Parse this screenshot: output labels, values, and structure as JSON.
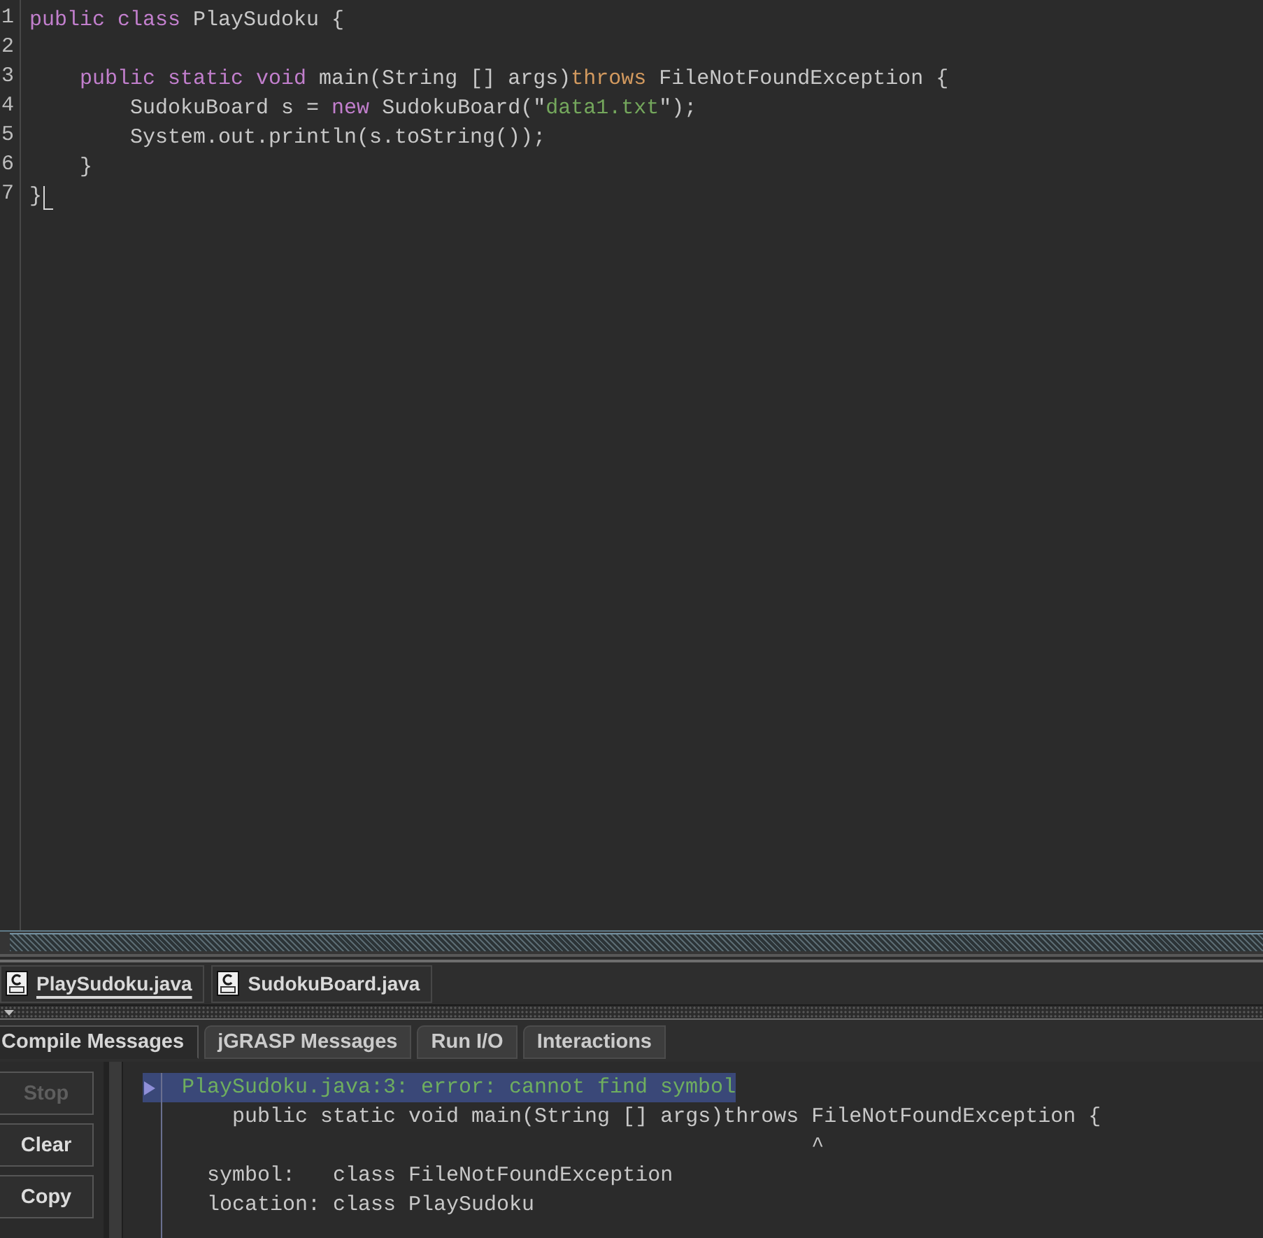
{
  "editor": {
    "lines": [
      {
        "number": "1",
        "cursor": false,
        "tokens": [
          {
            "kind": "keyword",
            "text": "public class"
          },
          {
            "kind": "plain",
            "text": " PlaySudoku {"
          }
        ]
      },
      {
        "number": "2",
        "cursor": false
      },
      {
        "number": "3",
        "cursor": false,
        "tokens": [
          {
            "kind": "keyword",
            "text": "    public static void"
          },
          {
            "kind": "plain",
            "text": " main(String [] args)"
          },
          {
            "kind": "clause",
            "text": "throws"
          },
          {
            "kind": "plain",
            "text": " FileNotFoundException {"
          }
        ]
      },
      {
        "number": "4",
        "cursor": false,
        "tokens": [
          {
            "kind": "plain",
            "text": "        SudokuBoard s = "
          },
          {
            "kind": "keyword",
            "text": "new"
          },
          {
            "kind": "plain",
            "text": " SudokuBoard(\""
          },
          {
            "kind": "string",
            "text": "data1.txt"
          },
          {
            "kind": "plain",
            "text": "\");"
          }
        ]
      },
      {
        "number": "5",
        "cursor": false,
        "tokens": [
          {
            "kind": "plain",
            "text": "        System.out.println(s.toString());"
          }
        ]
      },
      {
        "number": "6",
        "cursor": false,
        "tokens": [
          {
            "kind": "plain",
            "text": "    }"
          }
        ]
      },
      {
        "number": "7",
        "cursor": true,
        "tokens": [
          {
            "kind": "plain",
            "text": "}"
          }
        ]
      }
    ]
  },
  "file_tabs": [
    {
      "label": "PlaySudoku.java",
      "selected": true
    },
    {
      "label": "SudokuBoard.java",
      "selected": false
    }
  ],
  "message_tabs": [
    {
      "label": "Compile Messages",
      "selected": true
    },
    {
      "label": "jGRASP Messages",
      "selected": false
    },
    {
      "label": "Run I/O",
      "selected": false
    },
    {
      "label": "Interactions",
      "selected": false
    }
  ],
  "buttons": [
    {
      "label": "Stop",
      "disabled": true
    },
    {
      "label": "Clear",
      "disabled": false
    },
    {
      "label": "Copy",
      "disabled": false
    }
  ],
  "messages": [
    {
      "kind": "error",
      "selected": true,
      "text": "PlaySudoku.java:3: error: cannot find symbol"
    },
    {
      "kind": "output",
      "selected": false,
      "text": "    public static void main(String [] args)throws FileNotFoundException {"
    },
    {
      "kind": "output",
      "selected": false,
      "text": "                                                  ^"
    },
    {
      "kind": "output",
      "selected": false,
      "text": "  symbol:   class FileNotFoundException"
    },
    {
      "kind": "output",
      "selected": false,
      "text": "  location: class PlaySudoku"
    }
  ]
}
